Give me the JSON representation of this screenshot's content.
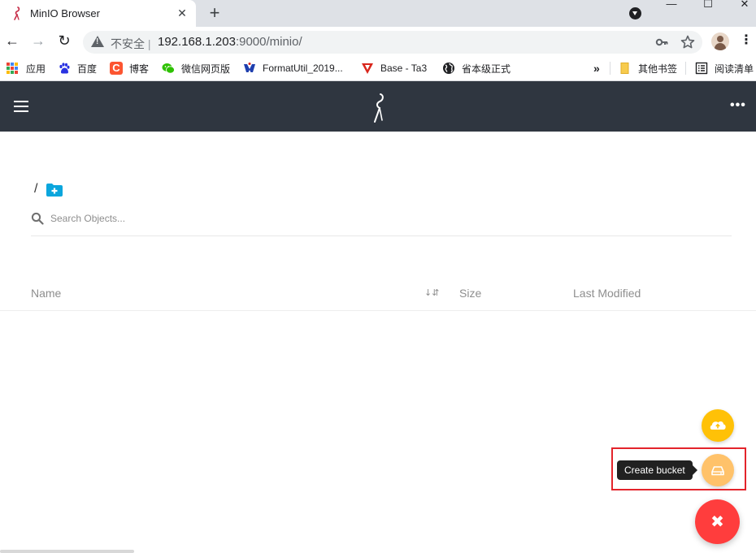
{
  "browser": {
    "tab": {
      "title": "MinIO Browser",
      "close_glyph": "✕"
    },
    "new_tab_glyph": "+",
    "window_controls": {
      "minimize": "—",
      "maximize": "☐",
      "close": "✕"
    },
    "nav": {
      "back": "←",
      "forward": "→",
      "reload": "↻"
    },
    "omnibox": {
      "security_label": "不安全",
      "separator": "|",
      "url_host": "192.168.1.203",
      "url_rest": ":9000/minio/"
    },
    "omnibox_icons": {
      "key": "key-icon",
      "star": "star-icon"
    },
    "menu_glyph": "⋮",
    "bookmarks": [
      {
        "label": "应用",
        "icon": "apps-grid-icon"
      },
      {
        "label": "百度",
        "icon": "baidu-paw-icon",
        "color": "#2932e1"
      },
      {
        "label": "博客",
        "icon": "csdn-c-icon",
        "color": "#fc5531"
      },
      {
        "label": "微信网页版",
        "icon": "wechat-icon",
        "color": "#2dc100"
      },
      {
        "label": "FormatUtil_2019...",
        "icon": "formatutil-icon",
        "color": "#1f3fae"
      },
      {
        "label": "Base - Ta3",
        "icon": "base-ta3-icon",
        "color": "#d9261c"
      },
      {
        "label": "省本级正式",
        "icon": "globe-icon",
        "color": "#202124"
      }
    ],
    "bookmarks_overflow": "»",
    "bookmarks_right": [
      {
        "label": "其他书签",
        "icon": "folder-icon",
        "color": "#f7cb4d"
      },
      {
        "label": "阅读清单",
        "icon": "reading-list-icon",
        "color": "#202124"
      }
    ]
  },
  "header": {
    "background": "#2f3640",
    "more_glyph": "•••"
  },
  "breadcrumb": {
    "root": "/"
  },
  "search": {
    "placeholder": "Search Objects..."
  },
  "table": {
    "columns": {
      "name": "Name",
      "sort": "↓⇵",
      "size": "Size",
      "modified": "Last Modified"
    }
  },
  "fab": {
    "tooltip": "Create bucket",
    "close_glyph": "✖",
    "colors": {
      "upload": "#ffc107",
      "bucket": "#ffc26a",
      "close": "#ff3d3d"
    }
  },
  "annotation": {
    "highlight_color": "#e3242b"
  }
}
